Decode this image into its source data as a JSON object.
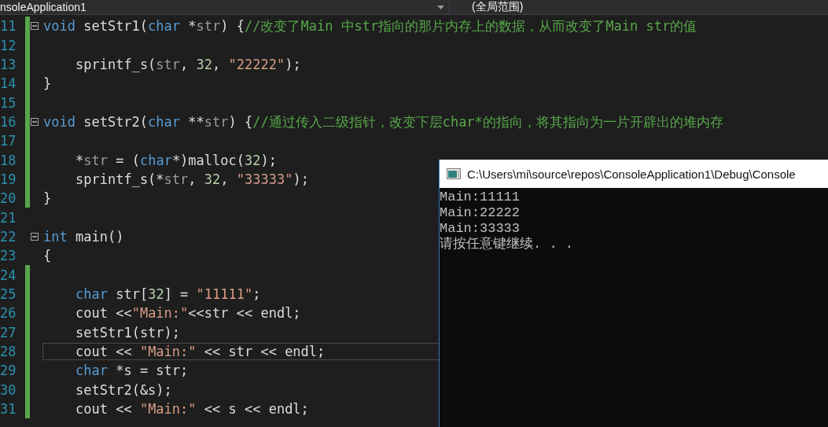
{
  "editor": {
    "navigation_bar": {
      "project": "nsoleApplication1",
      "scope": "(全局范围)"
    },
    "lines": [
      {
        "number": "11",
        "changed": true,
        "collapsible": true,
        "indented": false,
        "selected": false,
        "segments": [
          {
            "kind": "keyword",
            "text": "void"
          },
          {
            "kind": "plain",
            "text": " setStr1("
          },
          {
            "kind": "keyword",
            "text": "char"
          },
          {
            "kind": "plain",
            "text": " *"
          },
          {
            "kind": "param",
            "text": "str"
          },
          {
            "kind": "plain",
            "text": ") {"
          },
          {
            "kind": "comment",
            "text": "//改变了Main 中str指向的那片内存上的数据，从而改变了Main str的值"
          }
        ]
      },
      {
        "number": "12",
        "changed": true,
        "collapsible": false,
        "selected": false
      },
      {
        "number": "13",
        "changed": true,
        "collapsible": false,
        "indented": true,
        "selected": false,
        "segments": [
          {
            "kind": "plain",
            "text": "sprintf_s("
          },
          {
            "kind": "param",
            "text": "str"
          },
          {
            "kind": "plain",
            "text": ", "
          },
          {
            "kind": "number",
            "text": "32"
          },
          {
            "kind": "plain",
            "text": ", "
          },
          {
            "kind": "string",
            "text": "\"22222\""
          },
          {
            "kind": "plain",
            "text": ");"
          }
        ]
      },
      {
        "number": "14",
        "changed": true,
        "collapsible": false,
        "indented": false,
        "selected": false,
        "segments": [
          {
            "kind": "plain",
            "text": "}"
          }
        ]
      },
      {
        "number": "15",
        "changed": true,
        "collapsible": false,
        "selected": false
      },
      {
        "number": "16",
        "changed": true,
        "collapsible": true,
        "indented": false,
        "selected": false,
        "segments": [
          {
            "kind": "keyword",
            "text": "void"
          },
          {
            "kind": "plain",
            "text": " setStr2("
          },
          {
            "kind": "keyword",
            "text": "char"
          },
          {
            "kind": "plain",
            "text": " **"
          },
          {
            "kind": "param",
            "text": "str"
          },
          {
            "kind": "plain",
            "text": ") {"
          },
          {
            "kind": "comment",
            "text": "//通过传入二级指针，改变下层char*的指向，将其指向为一片开辟出的堆内存"
          }
        ]
      },
      {
        "number": "17",
        "changed": true,
        "collapsible": false,
        "selected": false
      },
      {
        "number": "18",
        "changed": true,
        "collapsible": false,
        "indented": true,
        "selected": false,
        "segments": [
          {
            "kind": "plain",
            "text": "*"
          },
          {
            "kind": "param",
            "text": "str"
          },
          {
            "kind": "plain",
            "text": " = ("
          },
          {
            "kind": "keyword",
            "text": "char"
          },
          {
            "kind": "plain",
            "text": "*)malloc("
          },
          {
            "kind": "number",
            "text": "32"
          },
          {
            "kind": "plain",
            "text": ");"
          }
        ]
      },
      {
        "number": "19",
        "changed": true,
        "collapsible": false,
        "indented": true,
        "selected": false,
        "segments": [
          {
            "kind": "plain",
            "text": "sprintf_s(*"
          },
          {
            "kind": "param",
            "text": "str"
          },
          {
            "kind": "plain",
            "text": ", "
          },
          {
            "kind": "number",
            "text": "32"
          },
          {
            "kind": "plain",
            "text": ", "
          },
          {
            "kind": "string",
            "text": "\"33333\""
          },
          {
            "kind": "plain",
            "text": ");"
          }
        ]
      },
      {
        "number": "20",
        "changed": true,
        "collapsible": false,
        "indented": false,
        "selected": false,
        "segments": [
          {
            "kind": "plain",
            "text": "}"
          }
        ]
      },
      {
        "number": "21",
        "changed": false,
        "collapsible": false,
        "selected": false
      },
      {
        "number": "22",
        "changed": false,
        "collapsible": true,
        "indented": false,
        "selected": false,
        "segments": [
          {
            "kind": "keyword",
            "text": "int"
          },
          {
            "kind": "plain",
            "text": " main()"
          }
        ]
      },
      {
        "number": "23",
        "changed": false,
        "collapsible": false,
        "indented": false,
        "selected": false,
        "segments": [
          {
            "kind": "plain",
            "text": "{"
          }
        ]
      },
      {
        "number": "24",
        "changed": true,
        "collapsible": false,
        "selected": false
      },
      {
        "number": "25",
        "changed": true,
        "collapsible": false,
        "indented": true,
        "selected": false,
        "segments": [
          {
            "kind": "keyword",
            "text": "char"
          },
          {
            "kind": "plain",
            "text": " str["
          },
          {
            "kind": "number",
            "text": "32"
          },
          {
            "kind": "plain",
            "text": "] = "
          },
          {
            "kind": "string",
            "text": "\"11111\""
          },
          {
            "kind": "plain",
            "text": ";"
          }
        ]
      },
      {
        "number": "26",
        "changed": true,
        "collapsible": false,
        "indented": true,
        "selected": false,
        "segments": [
          {
            "kind": "plain",
            "text": "cout <<"
          },
          {
            "kind": "string",
            "text": "\"Main:\""
          },
          {
            "kind": "plain",
            "text": "<<str << endl;"
          }
        ]
      },
      {
        "number": "27",
        "changed": true,
        "collapsible": false,
        "indented": true,
        "selected": false,
        "segments": [
          {
            "kind": "plain",
            "text": "setStr1(str);"
          }
        ]
      },
      {
        "number": "28",
        "changed": true,
        "collapsible": false,
        "indented": true,
        "selected": true,
        "segments": [
          {
            "kind": "plain",
            "text": "cout << "
          },
          {
            "kind": "string",
            "text": "\"Main:\""
          },
          {
            "kind": "plain",
            "text": " << str << endl;"
          }
        ]
      },
      {
        "number": "29",
        "changed": true,
        "collapsible": false,
        "indented": true,
        "selected": false,
        "segments": [
          {
            "kind": "keyword",
            "text": "char"
          },
          {
            "kind": "plain",
            "text": " *s = str;"
          }
        ]
      },
      {
        "number": "30",
        "changed": true,
        "collapsible": false,
        "indented": true,
        "selected": false,
        "segments": [
          {
            "kind": "plain",
            "text": "setStr2(&s);"
          }
        ]
      },
      {
        "number": "31",
        "changed": true,
        "collapsible": false,
        "indented": true,
        "selected": false,
        "segments": [
          {
            "kind": "plain",
            "text": "cout << "
          },
          {
            "kind": "string",
            "text": "\"Main:\""
          },
          {
            "kind": "plain",
            "text": " << s << endl;"
          }
        ]
      }
    ]
  },
  "console": {
    "title": "C:\\Users\\mi\\source\\repos\\ConsoleApplication1\\Debug\\Console",
    "output": [
      "Main:11111",
      "Main:22222",
      "Main:33333",
      "请按任意键继续. . ."
    ]
  }
}
